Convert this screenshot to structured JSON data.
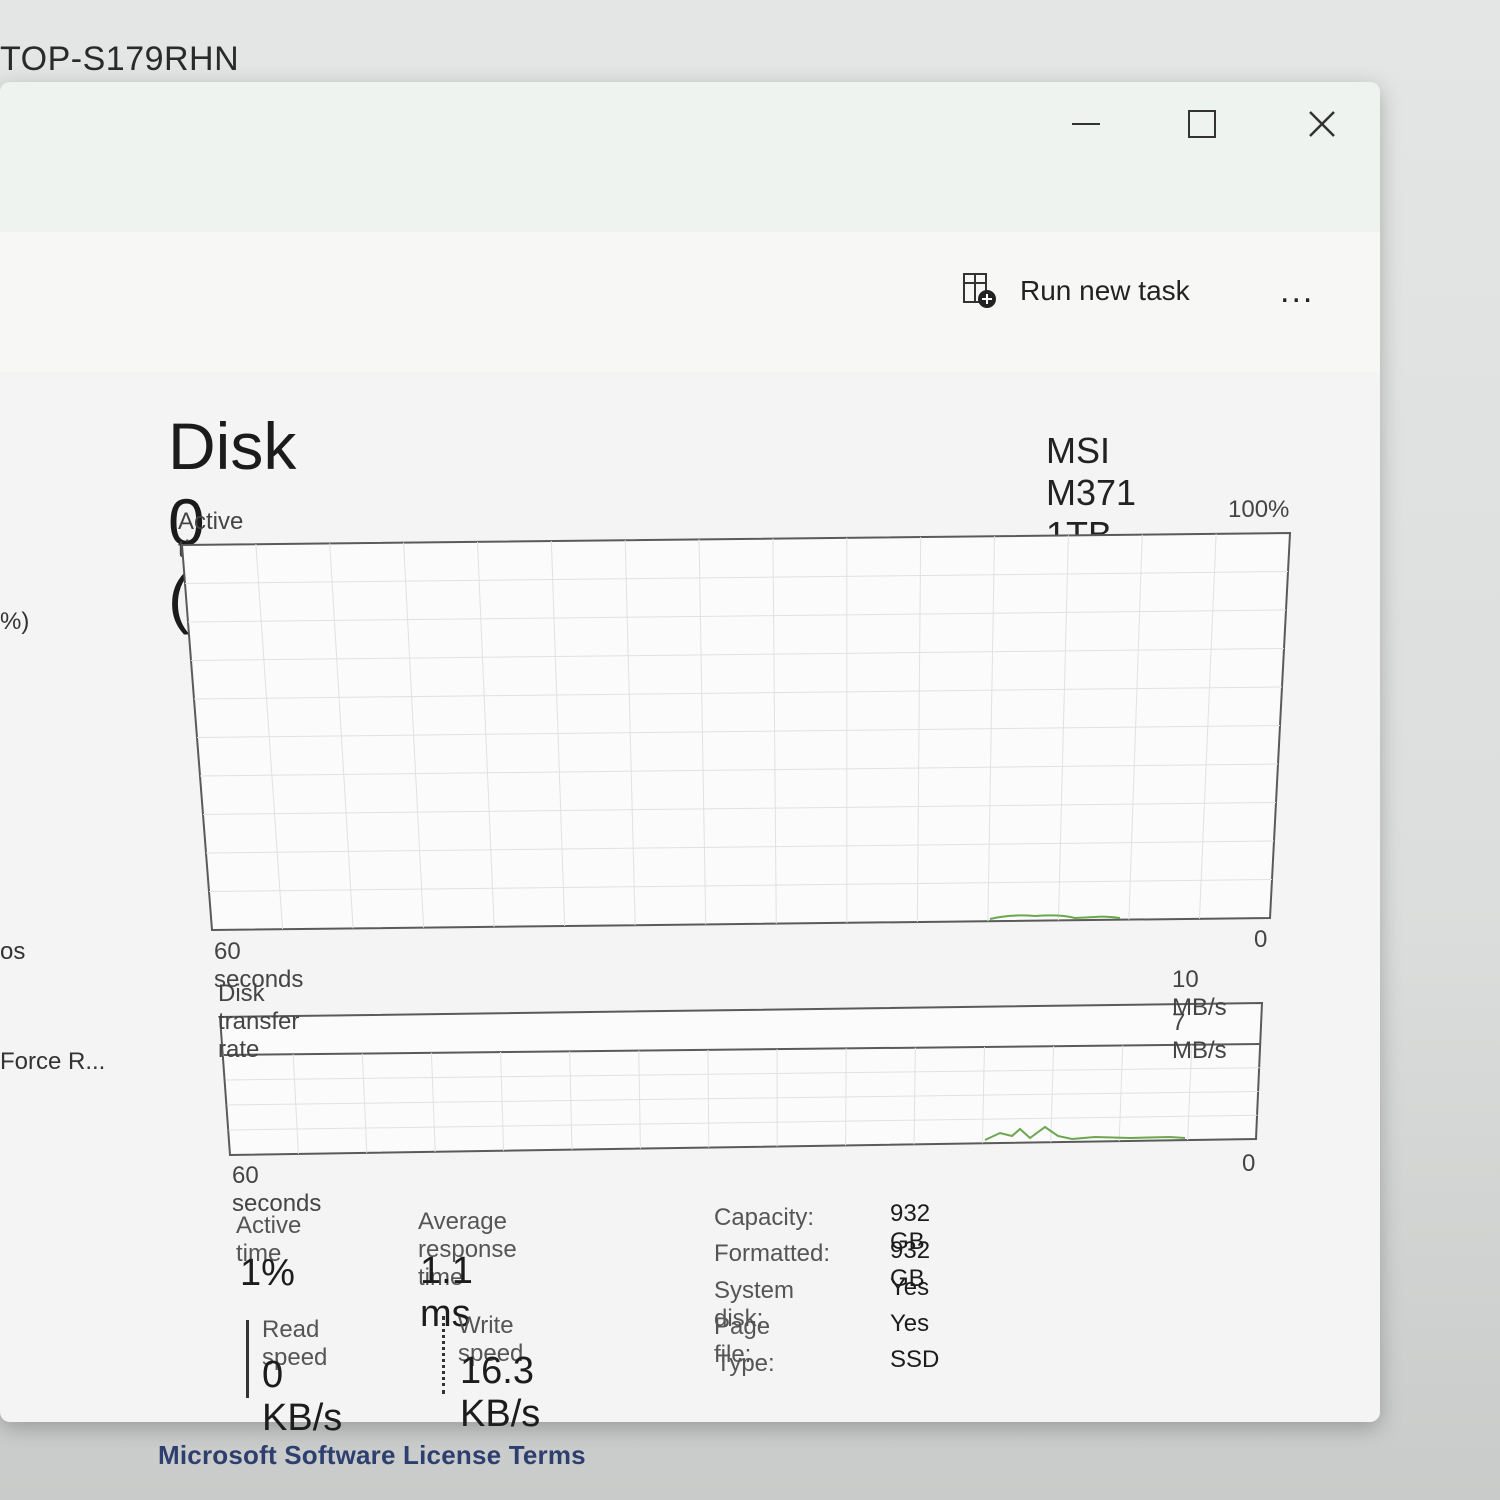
{
  "background": {
    "title_fragment": "TOP-S179RHN",
    "footer_link": "Microsoft Software License Terms"
  },
  "window_controls": {
    "minimize": "minimize-icon",
    "maximize": "maximize-icon",
    "close": "close-icon"
  },
  "toolbar": {
    "run_new_task": "Run new task",
    "more": "..."
  },
  "sidebar_fragments": [
    "%)",
    "os",
    "Force R..."
  ],
  "disk": {
    "title": "Disk 0 (C:)",
    "model": "MSI M371 1TB"
  },
  "active_time_chart": {
    "label": "Active time",
    "max_label": "100%",
    "x_label": "60 seconds",
    "min_label": "0"
  },
  "transfer_chart": {
    "label": "Disk transfer rate",
    "max_label": "10 MB/s",
    "line_label": "7 MB/s",
    "x_label": "60 seconds",
    "min_label": "0"
  },
  "stats": {
    "active_time_label": "Active time",
    "active_time_value": "1%",
    "avg_response_label": "Average response time",
    "avg_response_value": "1.1 ms",
    "read_label": "Read speed",
    "read_value": "0 KB/s",
    "write_label": "Write speed",
    "write_value": "16.3 KB/s"
  },
  "properties": [
    {
      "label": "Capacity:",
      "value": "932 GB"
    },
    {
      "label": "Formatted:",
      "value": "932 GB"
    },
    {
      "label": "System disk:",
      "value": "Yes"
    },
    {
      "label": "Page file:",
      "value": "Yes"
    },
    {
      "label": "Type:",
      "value": "SSD"
    }
  ],
  "colors": {
    "graph_line": "#6aa84f",
    "graph_border": "#5a5a5a",
    "grid": "#dcdcdc"
  }
}
